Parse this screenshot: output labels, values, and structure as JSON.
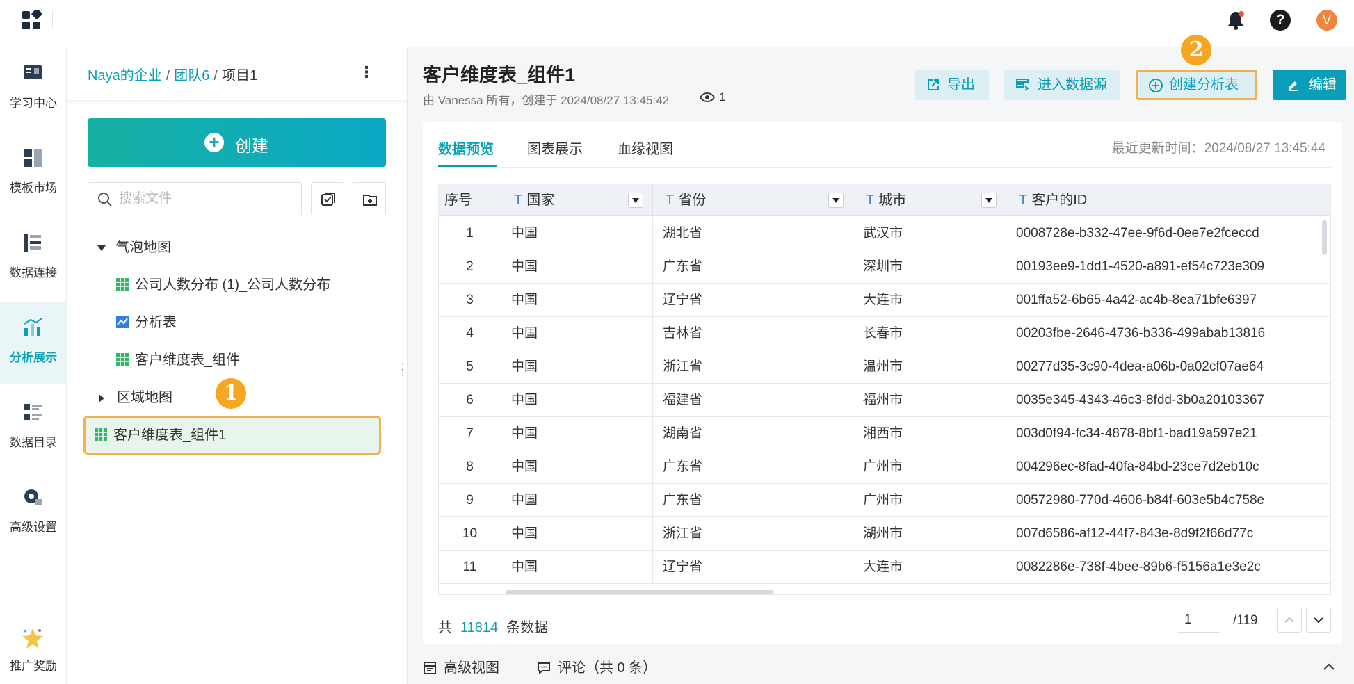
{
  "nav": {
    "items": [
      {
        "label": "学习中心",
        "icon": "book-icon"
      },
      {
        "label": "模板市场",
        "icon": "template-icon"
      },
      {
        "label": "数据连接",
        "icon": "database-icon"
      },
      {
        "label": "分析展示",
        "icon": "bar-chart-icon"
      },
      {
        "label": "数据目录",
        "icon": "catalog-icon"
      },
      {
        "label": "高级设置",
        "icon": "settings-icon"
      },
      {
        "label": "推广奖励",
        "icon": "star-icon"
      }
    ],
    "active": "分析展示"
  },
  "topbar": {
    "avatar_letter": "V",
    "help_glyph": "?"
  },
  "breadcrumb": {
    "org": "Naya的企业",
    "team": "团队6",
    "project": "项目1",
    "sep": "/"
  },
  "file_panel": {
    "create_label": "创建",
    "search_placeholder": "搜索文件",
    "tree": {
      "folder1": "气泡地图",
      "children": [
        "公司人数分布 (1)_公司人数分布",
        "分析表",
        "客户维度表_组件"
      ],
      "folder2": "区域地图",
      "selected": "客户维度表_组件1"
    },
    "badge1": "1"
  },
  "main": {
    "title": "客户维度表_组件1",
    "meta": "由 Vanessa 所有，创建于 2024/08/27 13:45:42",
    "views": "1",
    "buttons": {
      "export": "导出",
      "datasource": "进入数据源",
      "create_analysis": "创建分析表",
      "edit": "编辑"
    },
    "badge2": "2",
    "tabs": [
      "数据预览",
      "图表展示",
      "血缘视图"
    ],
    "updated": "最近更新时间：2024/08/27 13:45:44"
  },
  "table": {
    "type_glyph": "T",
    "headers": [
      "序号",
      "国家",
      "省份",
      "城市",
      "客户的ID"
    ],
    "rows": [
      [
        "1",
        "中国",
        "湖北省",
        "武汉市",
        "0008728e-b332-47ee-9f6d-0ee7e2fceccd"
      ],
      [
        "2",
        "中国",
        "广东省",
        "深圳市",
        "00193ee9-1dd1-4520-a891-ef54c723e309"
      ],
      [
        "3",
        "中国",
        "辽宁省",
        "大连市",
        "001ffa52-6b65-4a42-ac4b-8ea71bfe6397"
      ],
      [
        "4",
        "中国",
        "吉林省",
        "长春市",
        "00203fbe-2646-4736-b336-499abab13816"
      ],
      [
        "5",
        "中国",
        "浙江省",
        "温州市",
        "00277d35-3c90-4dea-a06b-0a02cf07ae64"
      ],
      [
        "6",
        "中国",
        "福建省",
        "福州市",
        "0035e345-4343-46c3-8fdd-3b0a20103367"
      ],
      [
        "7",
        "中国",
        "湖南省",
        "湘西市",
        "003d0f94-fc34-4878-8bf1-bad19a597e21"
      ],
      [
        "8",
        "中国",
        "广东省",
        "广州市",
        "004296ec-8fad-40fa-84bd-23ce7d2eb10c"
      ],
      [
        "9",
        "中国",
        "广东省",
        "广州市",
        "00572980-770d-4606-b84f-603e5b4c758e"
      ],
      [
        "10",
        "中国",
        "浙江省",
        "湖州市",
        "007d6586-af12-44f7-843e-8d9f2f66d77c"
      ],
      [
        "11",
        "中国",
        "辽宁省",
        "大连市",
        "0082286e-738f-4bee-89b6-f5156a1e3e2c"
      ]
    ]
  },
  "footer": {
    "prefix": "共",
    "total": "11814",
    "suffix": "条数据",
    "page": "1",
    "pages": "/119"
  },
  "bottom": {
    "advanced_view": "高级视图",
    "comments": "评论（共 0 条）"
  },
  "colors": {
    "accent": "#0b9fb5",
    "highlight": "#f5a623",
    "selected_bg": "#e8f5ec"
  }
}
